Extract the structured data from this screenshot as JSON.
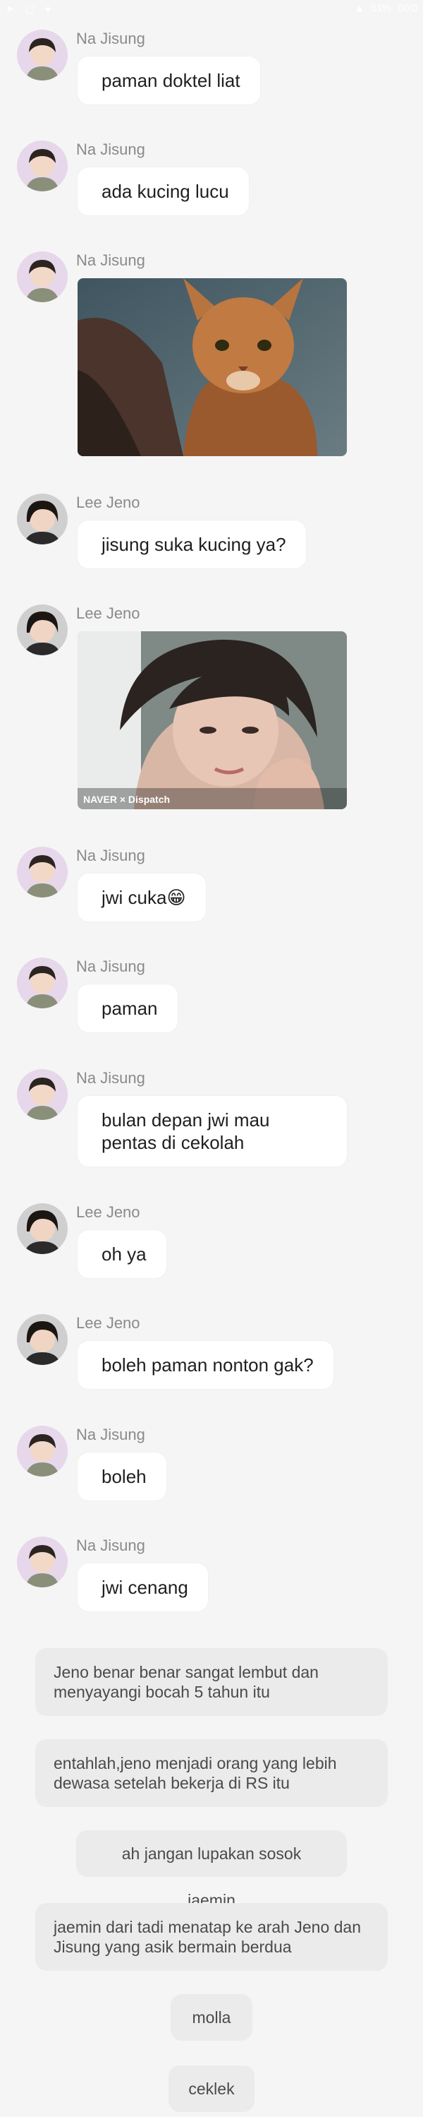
{
  "statusbar": {
    "time": "00:0",
    "battery": "51%"
  },
  "senders": {
    "jisung": "Na Jisung",
    "jeno": "Lee Jeno"
  },
  "messages": [
    {
      "sender": "Na Jisung",
      "text": "paman doktel liat"
    },
    {
      "sender": "Na Jisung",
      "text": "ada kucing lucu"
    },
    {
      "sender": "Na Jisung",
      "image": "cat-photo"
    },
    {
      "sender": "Lee Jeno",
      "text": "jisung suka kucing ya?"
    },
    {
      "sender": "Lee Jeno",
      "image": "portrait-photo",
      "watermark": "NAVER × Dispatch"
    },
    {
      "sender": "Na Jisung",
      "text": "jwi cuka😁"
    },
    {
      "sender": "Na Jisung",
      "text": "paman"
    },
    {
      "sender": "Na Jisung",
      "text": "bulan depan jwi mau pentas di cekolah"
    },
    {
      "sender": "Lee Jeno",
      "text": "oh ya"
    },
    {
      "sender": "Lee Jeno",
      "text": "boleh paman nonton gak?"
    },
    {
      "sender": "Na Jisung",
      "text": "boleh"
    },
    {
      "sender": "Na Jisung",
      "text": "jwi cenang"
    }
  ],
  "narration": [
    "Jeno benar benar sangat lembut dan menyayangi bocah 5 tahun itu",
    "entahlah,jeno menjadi orang yang lebih dewasa setelah bekerja di RS itu",
    "ah jangan lupakan sosok jaemin",
    "jaemin dari tadi menatap  ke arah Jeno dan Jisung yang asik bermain berdua",
    "molla",
    "ceklek"
  ],
  "icons": {
    "avatar_jisung": "avatar-jisung-icon",
    "avatar_jeno": "avatar-jeno-icon"
  },
  "colors": {
    "background": "#f5f5f5",
    "bubble": "#ffffff",
    "narration": "#ebebeb",
    "sender": "#8a8a8a"
  }
}
